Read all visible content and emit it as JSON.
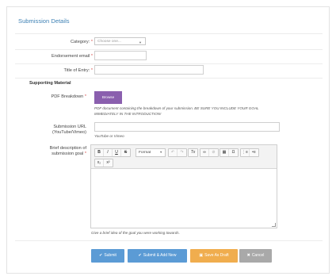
{
  "panel": {
    "title": "Submission Details"
  },
  "form": {
    "category": {
      "label": "Category:",
      "required_mark": "*",
      "placeholder": "Choose one..."
    },
    "endorsement_email": {
      "label": "Endorsement email",
      "required_mark": "*"
    },
    "title_of_entry": {
      "label": "Title of Entry:",
      "required_mark": "*"
    }
  },
  "supporting": {
    "heading": "Supporting Material",
    "pdf": {
      "label": "PDF Breakdown",
      "required_mark": "*",
      "browse_label": "Browse",
      "help_line1": "PDF document containing the breakdown of your submission. BE SURE YOU INCLUDE YOUR GOAL",
      "help_line2": "IMMEDIATELY IN THE INTRODUCTION!"
    },
    "url": {
      "label_line1": "Submission URL",
      "label_line2": "(YouTube/Vimeo)",
      "help": "YouTube or Vimeo"
    },
    "goal": {
      "label_line1": "Brief description of",
      "label_line2": "submission goal",
      "required_mark": "*",
      "help": "Give a brief idea of the goal you were working towards."
    }
  },
  "editor": {
    "toolbar": {
      "bold": "B",
      "italic": "I",
      "underline": "U",
      "strike": "S",
      "format": "Format",
      "undo": "↶",
      "redo": "↷",
      "clear_format": "Tx",
      "link": "∞",
      "unlink": "⊘",
      "table": "▦",
      "special_char": "Ω",
      "numbered_list": "⋮≡",
      "bulleted_list": "•≡",
      "subscript": "x₂",
      "superscript": "x²"
    }
  },
  "actions": {
    "submit": "Submit",
    "submit_add_new": "Submit & Add New",
    "save_draft": "Save As Draft",
    "cancel": "Cancel"
  },
  "colors": {
    "title": "#3f82b5",
    "browse": "#8a5fae",
    "submit": "#5b9bd5",
    "save_draft": "#f0ad4e",
    "cancel": "#a9a9a9",
    "required": "#d9534f"
  }
}
